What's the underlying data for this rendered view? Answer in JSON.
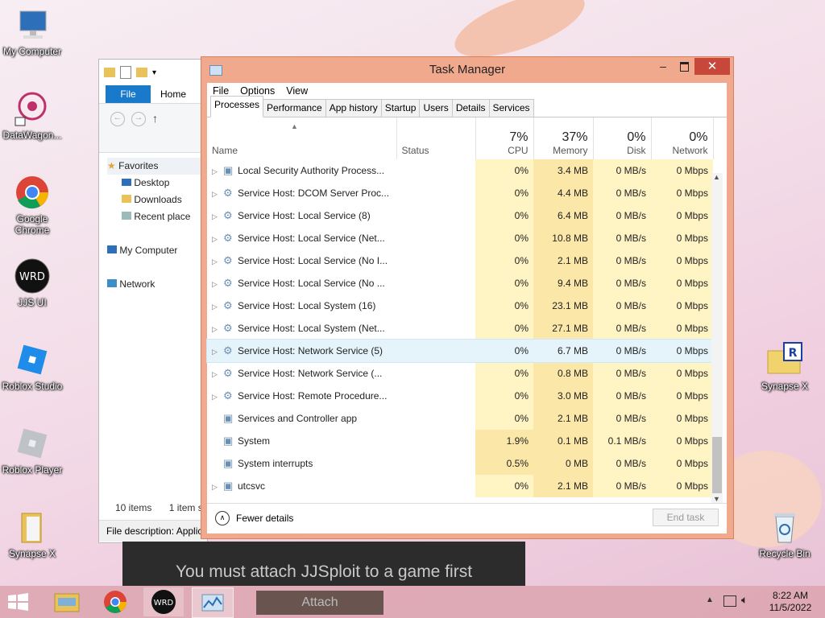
{
  "desktop_icons": [
    {
      "label": "My Computer",
      "icon": "computer-icon"
    },
    {
      "label": "DataWagon...",
      "icon": "datawagon-icon"
    },
    {
      "label": "Google Chrome",
      "icon": "chrome-icon"
    },
    {
      "label": "JJS UI",
      "icon": "jjs-icon"
    },
    {
      "label": "Roblox Studio",
      "icon": "roblox-studio-icon"
    },
    {
      "label": "Roblox Player",
      "icon": "roblox-player-icon"
    },
    {
      "label": "Synapse X",
      "icon": "folder-icon"
    },
    {
      "label": "Synapse X",
      "icon": "synapse-folder-icon"
    },
    {
      "label": "Recycle Bin",
      "icon": "recycle-bin-icon"
    }
  ],
  "explorer": {
    "ribbon_tabs": [
      "File",
      "Home"
    ],
    "nav": [
      "Favorites",
      "Desktop",
      "Downloads",
      "Recent place",
      "My Computer",
      "Network"
    ],
    "status_items": "10 items",
    "status_selected": "1 item s",
    "file_description": "File description: Applic"
  },
  "task_manager": {
    "title": "Task Manager",
    "menu": [
      "File",
      "Options",
      "View"
    ],
    "tabs": [
      "Processes",
      "Performance",
      "App history",
      "Startup",
      "Users",
      "Details",
      "Services"
    ],
    "columns": {
      "name": "Name",
      "status": "Status",
      "cpu_pct": "7%",
      "cpu": "CPU",
      "memory_pct": "37%",
      "memory": "Memory",
      "disk_pct": "0%",
      "disk": "Disk",
      "network_pct": "0%",
      "network": "Network"
    },
    "rows": [
      {
        "name": "Local Security Authority Process...",
        "cpu": "0%",
        "memory": "3.4 MB",
        "disk": "0 MB/s",
        "network": "0 Mbps"
      },
      {
        "name": "Service Host: DCOM Server Proc...",
        "cpu": "0%",
        "memory": "4.4 MB",
        "disk": "0 MB/s",
        "network": "0 Mbps"
      },
      {
        "name": "Service Host: Local Service (8)",
        "cpu": "0%",
        "memory": "6.4 MB",
        "disk": "0 MB/s",
        "network": "0 Mbps"
      },
      {
        "name": "Service Host: Local Service (Net...",
        "cpu": "0%",
        "memory": "10.8 MB",
        "disk": "0 MB/s",
        "network": "0 Mbps"
      },
      {
        "name": "Service Host: Local Service (No I...",
        "cpu": "0%",
        "memory": "2.1 MB",
        "disk": "0 MB/s",
        "network": "0 Mbps"
      },
      {
        "name": "Service Host: Local Service (No ...",
        "cpu": "0%",
        "memory": "9.4 MB",
        "disk": "0 MB/s",
        "network": "0 Mbps"
      },
      {
        "name": "Service Host: Local System (16)",
        "cpu": "0%",
        "memory": "23.1 MB",
        "disk": "0 MB/s",
        "network": "0 Mbps"
      },
      {
        "name": "Service Host: Local System (Net...",
        "cpu": "0%",
        "memory": "27.1 MB",
        "disk": "0 MB/s",
        "network": "0 Mbps"
      },
      {
        "name": "Service Host: Network Service (5)",
        "cpu": "0%",
        "memory": "6.7 MB",
        "disk": "0 MB/s",
        "network": "0 Mbps"
      },
      {
        "name": "Service Host: Network Service (...",
        "cpu": "0%",
        "memory": "0.8 MB",
        "disk": "0 MB/s",
        "network": "0 Mbps"
      },
      {
        "name": "Service Host: Remote Procedure...",
        "cpu": "0%",
        "memory": "3.0 MB",
        "disk": "0 MB/s",
        "network": "0 Mbps"
      },
      {
        "name": "Services and Controller app",
        "cpu": "0%",
        "memory": "2.1 MB",
        "disk": "0 MB/s",
        "network": "0 Mbps"
      },
      {
        "name": "System",
        "cpu": "1.9%",
        "memory": "0.1 MB",
        "disk": "0.1 MB/s",
        "network": "0 Mbps"
      },
      {
        "name": "System interrupts",
        "cpu": "0.5%",
        "memory": "0 MB",
        "disk": "0 MB/s",
        "network": "0 Mbps"
      },
      {
        "name": "utcsvc",
        "cpu": "0%",
        "memory": "2.1 MB",
        "disk": "0 MB/s",
        "network": "0 Mbps"
      }
    ],
    "fewer_details": "Fewer details",
    "end_task": "End task"
  },
  "overlay": {
    "message": "You must attach JJSploit to a game first",
    "attach": "Attach"
  },
  "clock": {
    "time": "8:22 AM",
    "date": "11/5/2022"
  },
  "colors": {
    "accent": "#f0a98c",
    "cell_highlight": "#fff4c4",
    "cell_highlight2": "#fbe7a8"
  }
}
